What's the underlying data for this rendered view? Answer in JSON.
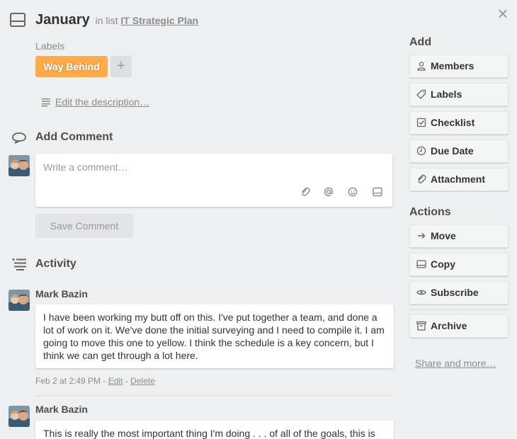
{
  "header": {
    "title": "January",
    "in_list_text": "in list",
    "list_name": "IT Strategic Plan",
    "close_glyph": "×"
  },
  "labels": {
    "heading": "Labels",
    "items": [
      {
        "text": "Way Behind",
        "color": "#ffab4a"
      }
    ],
    "add_glyph": "+"
  },
  "description": {
    "link_text": "Edit the description…"
  },
  "add_comment": {
    "title": "Add Comment",
    "placeholder": "Write a comment…",
    "icons": [
      "attachment-icon",
      "mention-icon",
      "emoji-icon",
      "card-icon"
    ],
    "save_label": "Save Comment"
  },
  "activity": {
    "title": "Activity",
    "comments": [
      {
        "author": "Mark Bazin",
        "text": "I have been working my butt off on this. I've put together a team, and done a lot of work on it. We've done the initial surveying and I need to compile it. I am going to move this one to yellow. I think the schedule is a key concern, but I think we can get through a lot here.",
        "timestamp": "Feb 2 at 2:49 PM",
        "edit_label": "Edit",
        "delete_label": "Delete"
      },
      {
        "author": "Mark Bazin",
        "text": "This is really the most important thing I'm doing . . . of all of the goals, this is"
      }
    ]
  },
  "sidebar": {
    "add_heading": "Add",
    "add_buttons": [
      {
        "label": "Members",
        "icon": "person-icon"
      },
      {
        "label": "Labels",
        "icon": "tag-icon"
      },
      {
        "label": "Checklist",
        "icon": "checkbox-icon"
      },
      {
        "label": "Due Date",
        "icon": "clock-icon"
      },
      {
        "label": "Attachment",
        "icon": "paperclip-icon"
      }
    ],
    "actions_heading": "Actions",
    "action_buttons": [
      {
        "label": "Move",
        "icon": "arrow-right-icon"
      },
      {
        "label": "Copy",
        "icon": "card-icon"
      },
      {
        "label": "Subscribe",
        "icon": "eye-icon"
      },
      {
        "label": "Archive",
        "icon": "archive-icon"
      }
    ],
    "share_link": "Share and more…"
  },
  "colors": {
    "background": "#edeff0",
    "label_orange": "#ffab4a",
    "muted_text": "#8c8c8c"
  }
}
